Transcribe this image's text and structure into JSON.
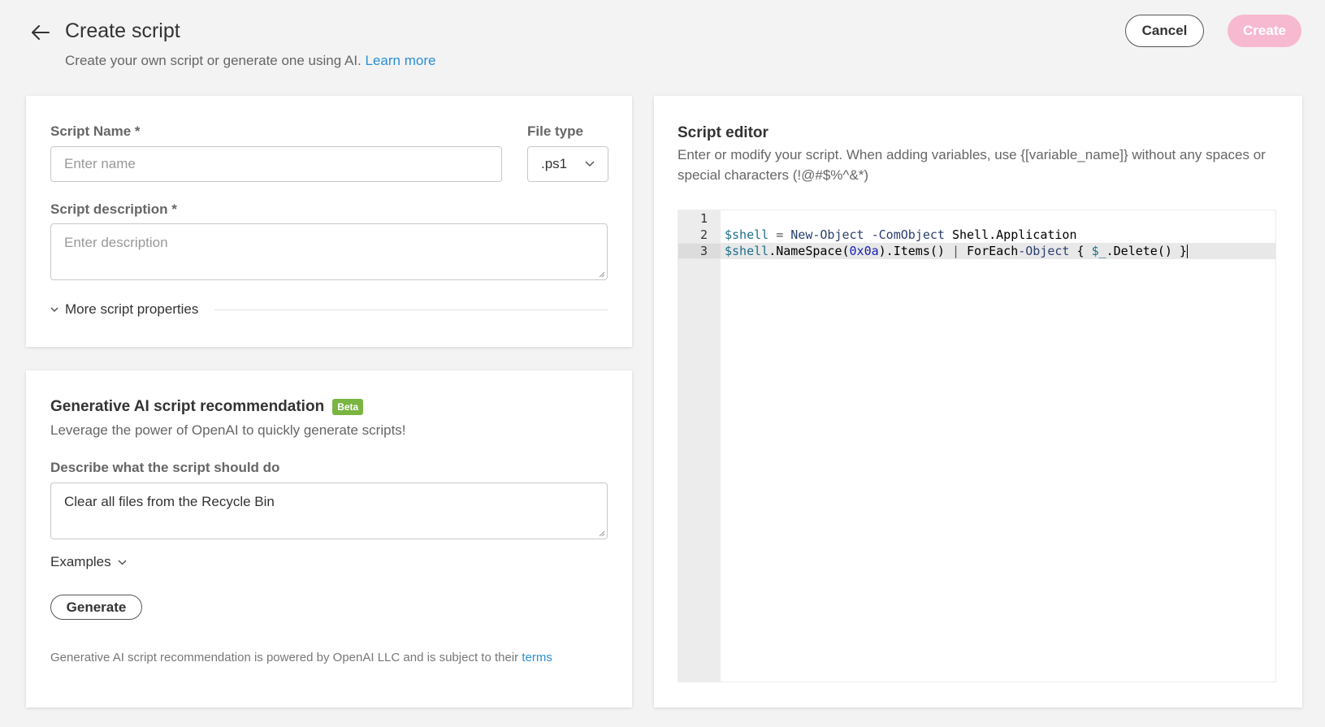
{
  "header": {
    "title": "Create script",
    "subtitle": "Create your own script or generate one using AI.",
    "learn_more": "Learn more",
    "cancel_label": "Cancel",
    "create_label": "Create"
  },
  "properties": {
    "script_name_label": "Script Name *",
    "script_name_placeholder": "Enter name",
    "file_type_label": "File type",
    "file_type_value": ".ps1",
    "description_label": "Script description *",
    "description_placeholder": "Enter description",
    "more_properties_label": "More script properties"
  },
  "ai": {
    "title": "Generative AI script recommendation",
    "badge": "Beta",
    "subtitle": "Leverage the power of OpenAI to quickly generate scripts!",
    "prompt_label": "Describe what the script should do",
    "prompt_value": "Clear all files from the Recycle Bin",
    "examples_label": "Examples",
    "generate_label": "Generate",
    "footer_text": "Generative AI script recommendation is powered by OpenAI LLC and is subject to their",
    "footer_link": "terms"
  },
  "editor": {
    "title": "Script editor",
    "description": "Enter or modify your script. When adding variables, use {[variable_name]} without any spaces or special characters (!@#$%^&*)",
    "lines": [
      {
        "num": "1",
        "code": ""
      },
      {
        "num": "2",
        "code": "$shell = New-Object -ComObject Shell.Application"
      },
      {
        "num": "3",
        "code": "$shell.NameSpace(0x0a).Items() | ForEach-Object { $_.Delete() }"
      }
    ]
  },
  "colors": {
    "accent": "#2b8fd6",
    "create_disabled": "#f7b9d0",
    "beta": "#7ab542",
    "background": "#f3f3f4"
  }
}
